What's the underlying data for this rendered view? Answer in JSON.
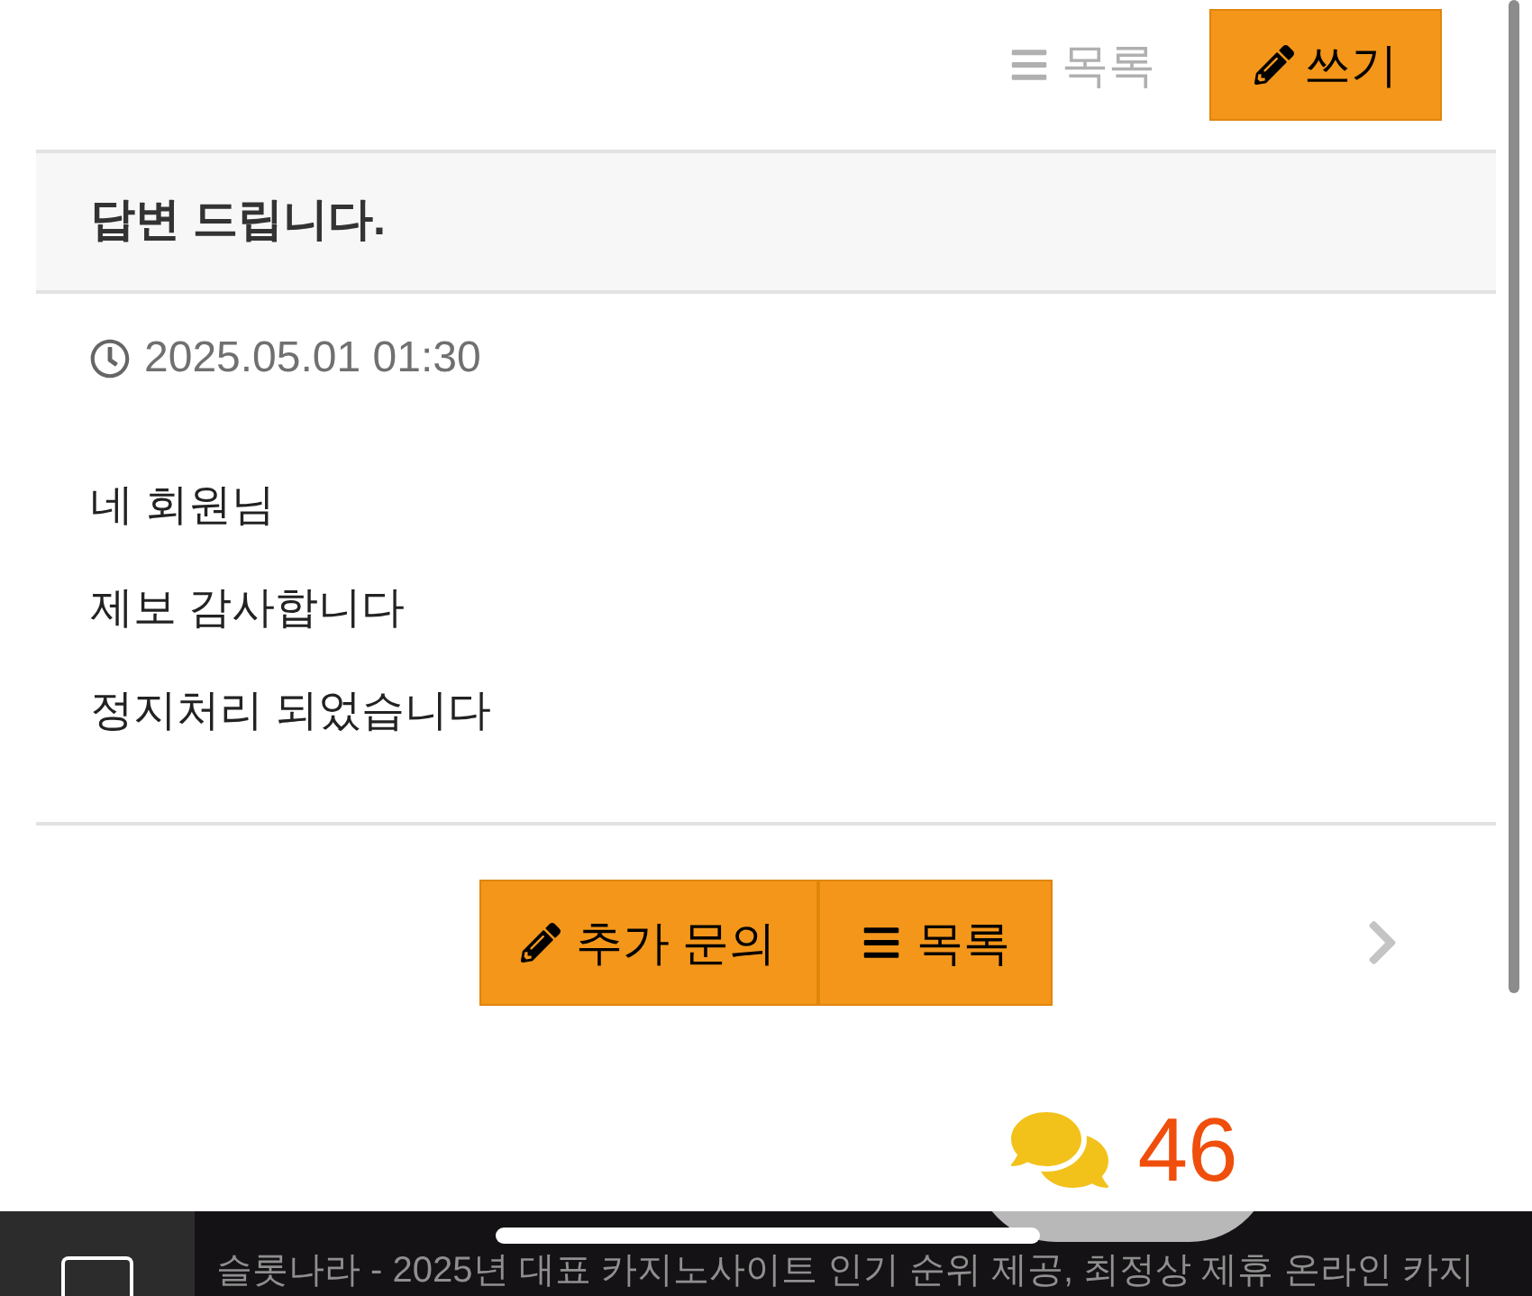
{
  "toolbar": {
    "list_link": {
      "label": "목록"
    },
    "write_button": {
      "label": "쓰기"
    }
  },
  "post": {
    "title": "답변 드립니다.",
    "date": "2025.05.01 01:30",
    "body": [
      "네 회원님",
      "제보 감사합니다",
      "정지처리 되었습니다"
    ]
  },
  "actions": [
    {
      "kind": "write",
      "label": "추가 문의"
    },
    {
      "kind": "list",
      "label": "목록"
    }
  ],
  "comment_badge": {
    "count": "46"
  },
  "footer_bar": {
    "text": "슬롯나라 - 2025년 대표 카지노사이트 인기 순위 제공, 최정상 제휴 온라인 카지"
  }
}
